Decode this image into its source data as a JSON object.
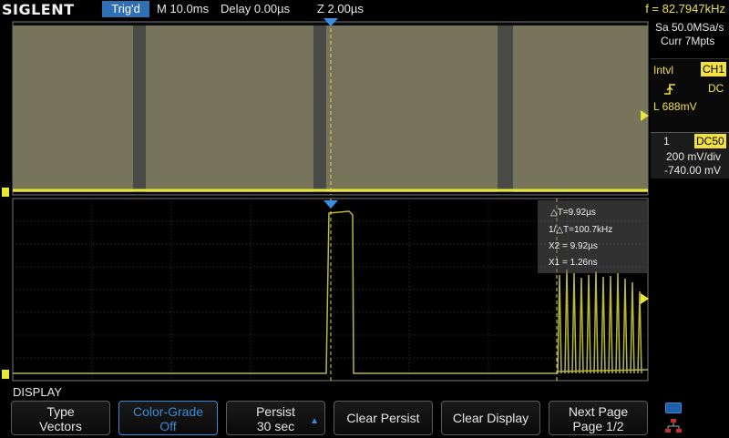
{
  "status_bar": {
    "brand": "SIGLENT",
    "trigger_status": "Trig'd",
    "timebase": "M 10.0ms",
    "delay": "Delay 0.00µs",
    "zoom": "Z 2.00µs",
    "frequency": "f = 82.7947kHz"
  },
  "acquisition": {
    "sample_rate": "Sa 50.0MSa/s",
    "memory_depth": "Curr 7Mpts"
  },
  "trigger_panel": {
    "mode": "Intvl",
    "source": "CH1",
    "coupling": "DC",
    "level": "L 688mV",
    "edge_icon": "rising-edge-icon"
  },
  "channel_panel": {
    "channel": "1",
    "coupling": "DC50",
    "scale": "200 mV/div",
    "offset": "-740.00 mV"
  },
  "cursor_readout": {
    "delta_t": "△T=9.92µs",
    "inverse_delta_t": "1/△T=100.7kHz",
    "x2": "X2 = 9.92µs",
    "x1": "X1 = 1.26ns"
  },
  "menu": {
    "title": "DISPLAY",
    "softkeys": [
      {
        "line1": "Type",
        "line2": "Vectors"
      },
      {
        "line1": "Color-Grade",
        "line2": "Off"
      },
      {
        "line1": "Persist",
        "line2": "30 sec"
      },
      {
        "label": "Clear Persist"
      },
      {
        "label": "Clear Display"
      },
      {
        "line1": "Next Page",
        "line2": "Page 1/2"
      }
    ]
  },
  "colors": {
    "trace": "#e6e636",
    "accent": "#2f6fb4",
    "active_softkey": "#3a8ad6",
    "channel_label": "#f0e040"
  }
}
